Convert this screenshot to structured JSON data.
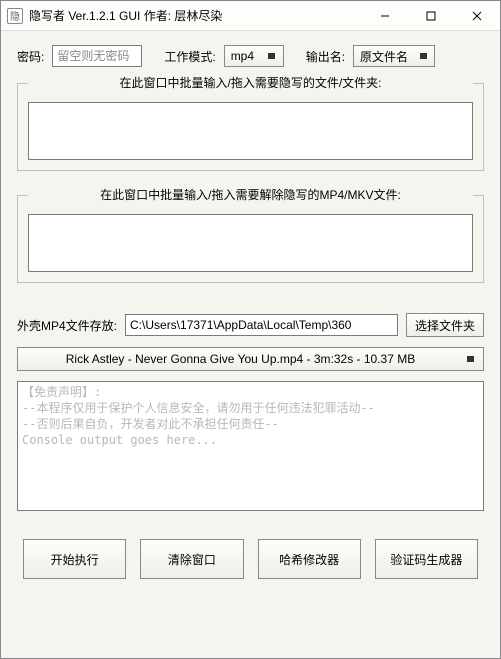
{
  "window": {
    "title": "隐写者 Ver.1.2.1 GUI 作者: 层林尽染"
  },
  "row1": {
    "password_label": "密码:",
    "password_placeholder": "留空则无密码",
    "mode_label": "工作模式:",
    "mode_value": "mp4",
    "output_label": "输出名:",
    "output_value": "原文件名"
  },
  "group_hide": {
    "caption": "在此窗口中批量输入/拖入需要隐写的文件/文件夹:"
  },
  "group_reveal": {
    "caption": "在此窗口中批量输入/拖入需要解除隐写的MP4/MKV文件:"
  },
  "shell": {
    "label": "外壳MP4文件存放:",
    "path": "C:\\Users\\17371\\AppData\\Local\\Temp\\360",
    "browse": "选择文件夹"
  },
  "file_combo": "Rick Astley - Never Gonna Give You Up.mp4 - 3m:32s - 10.37 MB",
  "console": "【免责声明】:\n--本程序仅用于保护个人信息安全，请勿用于任何违法犯罪活动--\n--否则后果自负，开发者对此不承担任何责任--\nConsole output goes here...",
  "buttons": {
    "start": "开始执行",
    "clear": "清除窗口",
    "hash": "哈希修改器",
    "verify": "验证码生成器"
  }
}
